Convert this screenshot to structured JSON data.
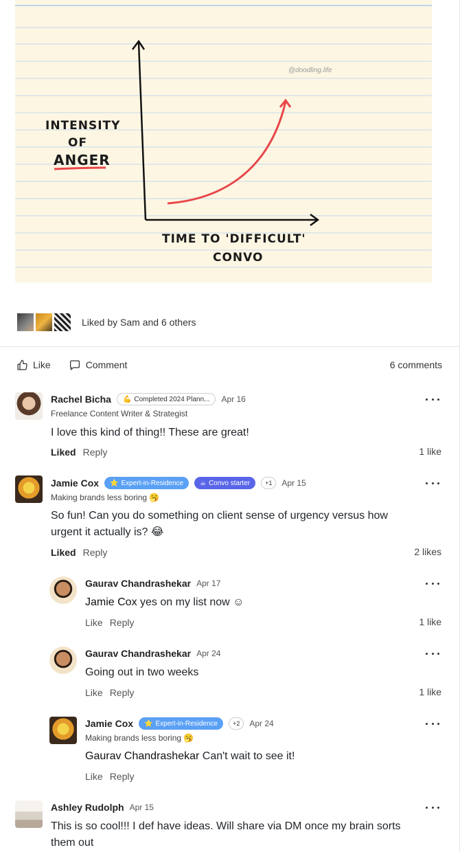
{
  "sketch": {
    "y_label": [
      "INTENSITY",
      "OF",
      "ANGER"
    ],
    "x_label": [
      "TIME TO 'DIFFICULT'",
      "CONVO"
    ],
    "watermark": "@doodling.life"
  },
  "likes": {
    "text": "Liked by Sam and 6 others"
  },
  "actions": {
    "like": "Like",
    "comment": "Comment",
    "count": "6 comments"
  },
  "comments": [
    {
      "author": "Rachel Bicha",
      "badge": "Completed 2024 Plann...",
      "badge_icon": "💪",
      "date": "Apr 16",
      "subtitle": "Freelance Content Writer & Strategist",
      "body": "I love this kind of thing!! These are great!",
      "liked": "Liked",
      "reply": "Reply",
      "count": "1 like"
    },
    {
      "author": "Jamie Cox",
      "badge1": "Expert-in-Residence",
      "badge2": "Convo starter",
      "plus": "+1",
      "date": "Apr 15",
      "subtitle": "Making brands less boring 🥱",
      "body": "So fun! Can you do something on client sense of urgency versus how urgent it actually is? 😂",
      "liked": "Liked",
      "reply": "Reply",
      "count": "2 likes"
    },
    {
      "author": "Gaurav Chandrashekar",
      "date": "Apr 17",
      "mention": "Jamie Cox",
      "body": " yes on my list now ☺",
      "like": "Like",
      "reply": "Reply",
      "count": "1 like"
    },
    {
      "author": "Gaurav Chandrashekar",
      "date": "Apr 24",
      "body": "Going out in two weeks",
      "like": "Like",
      "reply": "Reply",
      "count": "1 like"
    },
    {
      "author": "Jamie Cox",
      "badge1": "Expert-in-Residence",
      "plus": "+2",
      "date": "Apr 24",
      "subtitle": "Making brands less boring 🥱",
      "mention": "Gaurav Chandrashekar",
      "body": " Can't wait to see it!",
      "like": "Like",
      "reply": "Reply"
    },
    {
      "author": "Ashley Rudolph",
      "date": "Apr 15",
      "body": "This is so cool!!! I def have ideas. Will share via DM once my brain sorts them out"
    }
  ],
  "colors": {
    "curve": "#e8474a",
    "expert": "#5aa0f5",
    "convo": "#5965e8",
    "paper": "#fdf6e3",
    "lines": "#cfe0ea"
  }
}
